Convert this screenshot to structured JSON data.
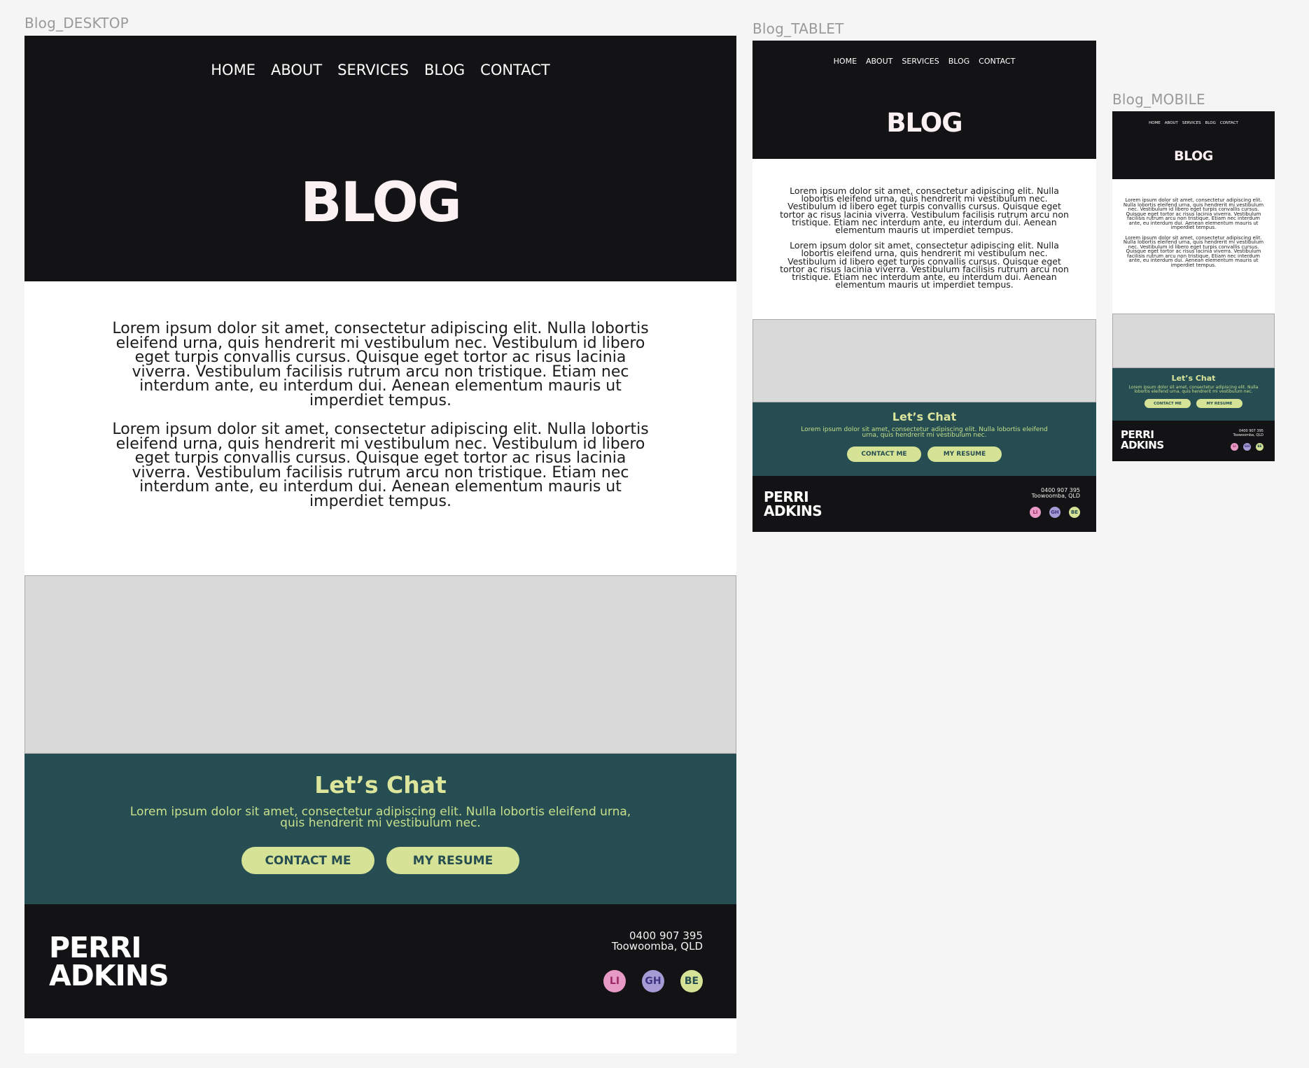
{
  "frames": {
    "desktop_label": "Blog_DESKTOP",
    "tablet_label": "Blog_TABLET",
    "mobile_label": "Blog_MOBILE"
  },
  "nav": {
    "items": [
      "HOME",
      "ABOUT",
      "SERVICES",
      "BLOG",
      "CONTACT"
    ]
  },
  "hero": {
    "title": "BLOG"
  },
  "content": {
    "paragraphs": [
      "Lorem ipsum dolor sit amet, consectetur adipiscing elit. Nulla lobortis eleifend urna, quis hendrerit mi vestibulum nec. Vestibulum id libero eget turpis convallis cursus. Quisque eget tortor ac risus lacinia viverra. Vestibulum facilisis rutrum arcu non tristique. Etiam nec interdum ante, eu interdum dui. Aenean elementum mauris ut imperdiet tempus.",
      "Lorem ipsum dolor sit amet, consectetur adipiscing elit. Nulla lobortis eleifend urna, quis hendrerit mi vestibulum nec. Vestibulum id libero eget turpis convallis cursus. Quisque eget tortor ac risus lacinia viverra. Vestibulum facilisis rutrum arcu non tristique. Etiam nec interdum ante, eu interdum dui. Aenean elementum mauris ut imperdiet tempus."
    ]
  },
  "chat": {
    "title": "Let’s Chat",
    "text": "Lorem ipsum dolor sit amet, consectetur adipiscing elit. Nulla lobortis eleifend urna, quis hendrerit mi vestibulum nec.",
    "contact_button": "CONTACT ME",
    "resume_button": "MY RESUME"
  },
  "footer": {
    "brand_line1": "PERRI",
    "brand_line2": "ADKINS",
    "phone": "0400 907 395",
    "location": "Toowoomba, QLD",
    "socials": [
      {
        "label": "LI",
        "icon": "linkedin-icon",
        "color": "#e89ac6"
      },
      {
        "label": "GH",
        "icon": "github-icon",
        "color": "#a79bd6"
      },
      {
        "label": "BE",
        "icon": "behance-icon",
        "color": "#d6e296"
      }
    ]
  },
  "colors": {
    "dark": "#131315",
    "teal": "#254d52",
    "lime": "#d6e296",
    "placeholder": "#d9d9d9"
  }
}
